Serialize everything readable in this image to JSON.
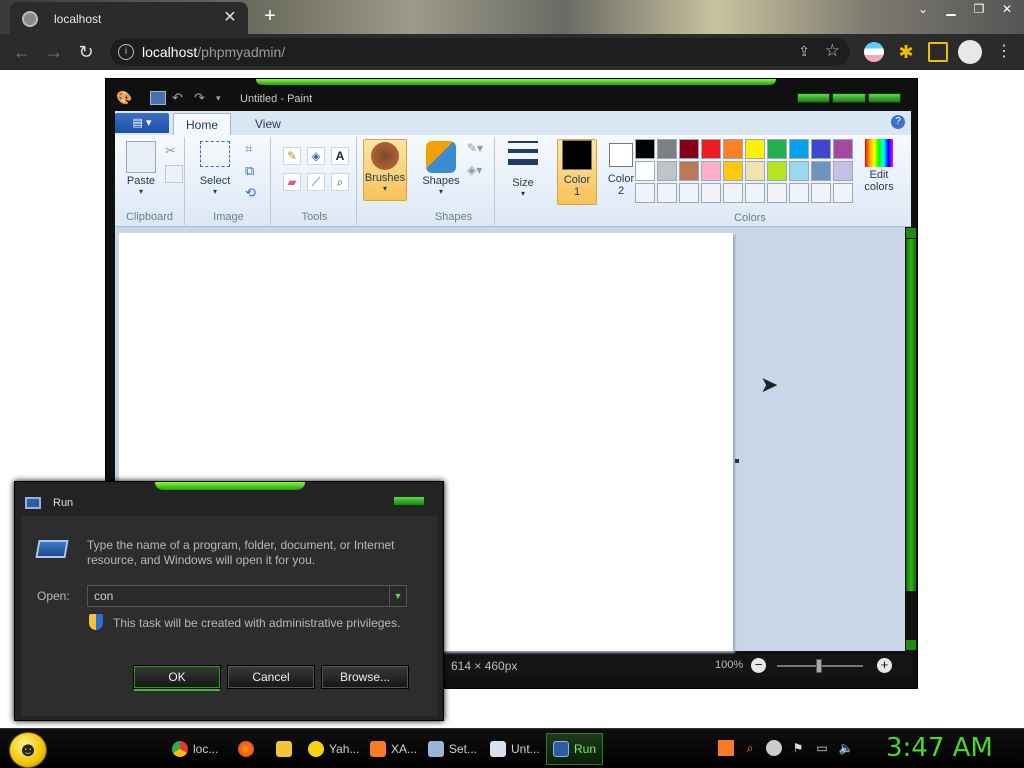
{
  "browser": {
    "tab_title": "localhost",
    "url_host": "localhost",
    "url_path": "/phpmyadmin/"
  },
  "paint": {
    "window_title": "Untitled - Paint",
    "tabs": {
      "home": "Home",
      "view": "View"
    },
    "groups": {
      "clipboard": "Clipboard",
      "image": "Image",
      "tools": "Tools",
      "shapes": "Shapes",
      "colors": "Colors"
    },
    "buttons": {
      "paste": "Paste",
      "select": "Select",
      "brushes": "Brushes",
      "shapes": "Shapes",
      "size": "Size",
      "color1_line1": "Color",
      "color1_line2": "1",
      "color2_line1": "Color",
      "color2_line2": "2",
      "edit_colors_line1": "Edit",
      "edit_colors_line2": "colors"
    },
    "palette": [
      "#000000",
      "#7f7f7f",
      "#880015",
      "#ed1c24",
      "#ff7f27",
      "#fff200",
      "#22b14c",
      "#00a2e8",
      "#3f48cc",
      "#a349a4",
      "#ffffff",
      "#c3c3c3",
      "#b97a57",
      "#ffaec9",
      "#ffc90e",
      "#efe4b0",
      "#b5e61d",
      "#99d9ea",
      "#7092be",
      "#c8bfe7",
      "#f0f4fa",
      "#f0f4fa",
      "#f0f4fa",
      "#f0f4fa",
      "#f0f4fa",
      "#f0f4fa",
      "#f0f4fa",
      "#f0f4fa",
      "#f0f4fa",
      "#f0f4fa"
    ],
    "color1": "#000000",
    "color2": "#ffffff",
    "status": {
      "dimensions": "614 × 460px",
      "zoom": "100%"
    }
  },
  "run_dialog": {
    "title": "Run",
    "description": "Type the name of a program, folder, document, or Internet resource, and Windows will open it for you.",
    "open_label": "Open:",
    "open_value": "con",
    "admin_note": "This task will be created with administrative privileges.",
    "ok": "OK",
    "cancel": "Cancel",
    "browse": "Browse..."
  },
  "taskbar": {
    "items": [
      {
        "label": "loc...",
        "icon": "chrome-icon"
      },
      {
        "label": "",
        "icon": "firefox-icon"
      },
      {
        "label": "",
        "icon": "folder-icon"
      },
      {
        "label": "Yah...",
        "icon": "yahoo-messenger-icon"
      },
      {
        "label": "XA...",
        "icon": "xampp-icon"
      },
      {
        "label": "Set...",
        "icon": "settings-icon"
      },
      {
        "label": "Unt...",
        "icon": "paint-icon"
      },
      {
        "label": "Run",
        "icon": "run-icon"
      }
    ],
    "clock": "3:47 AM"
  }
}
